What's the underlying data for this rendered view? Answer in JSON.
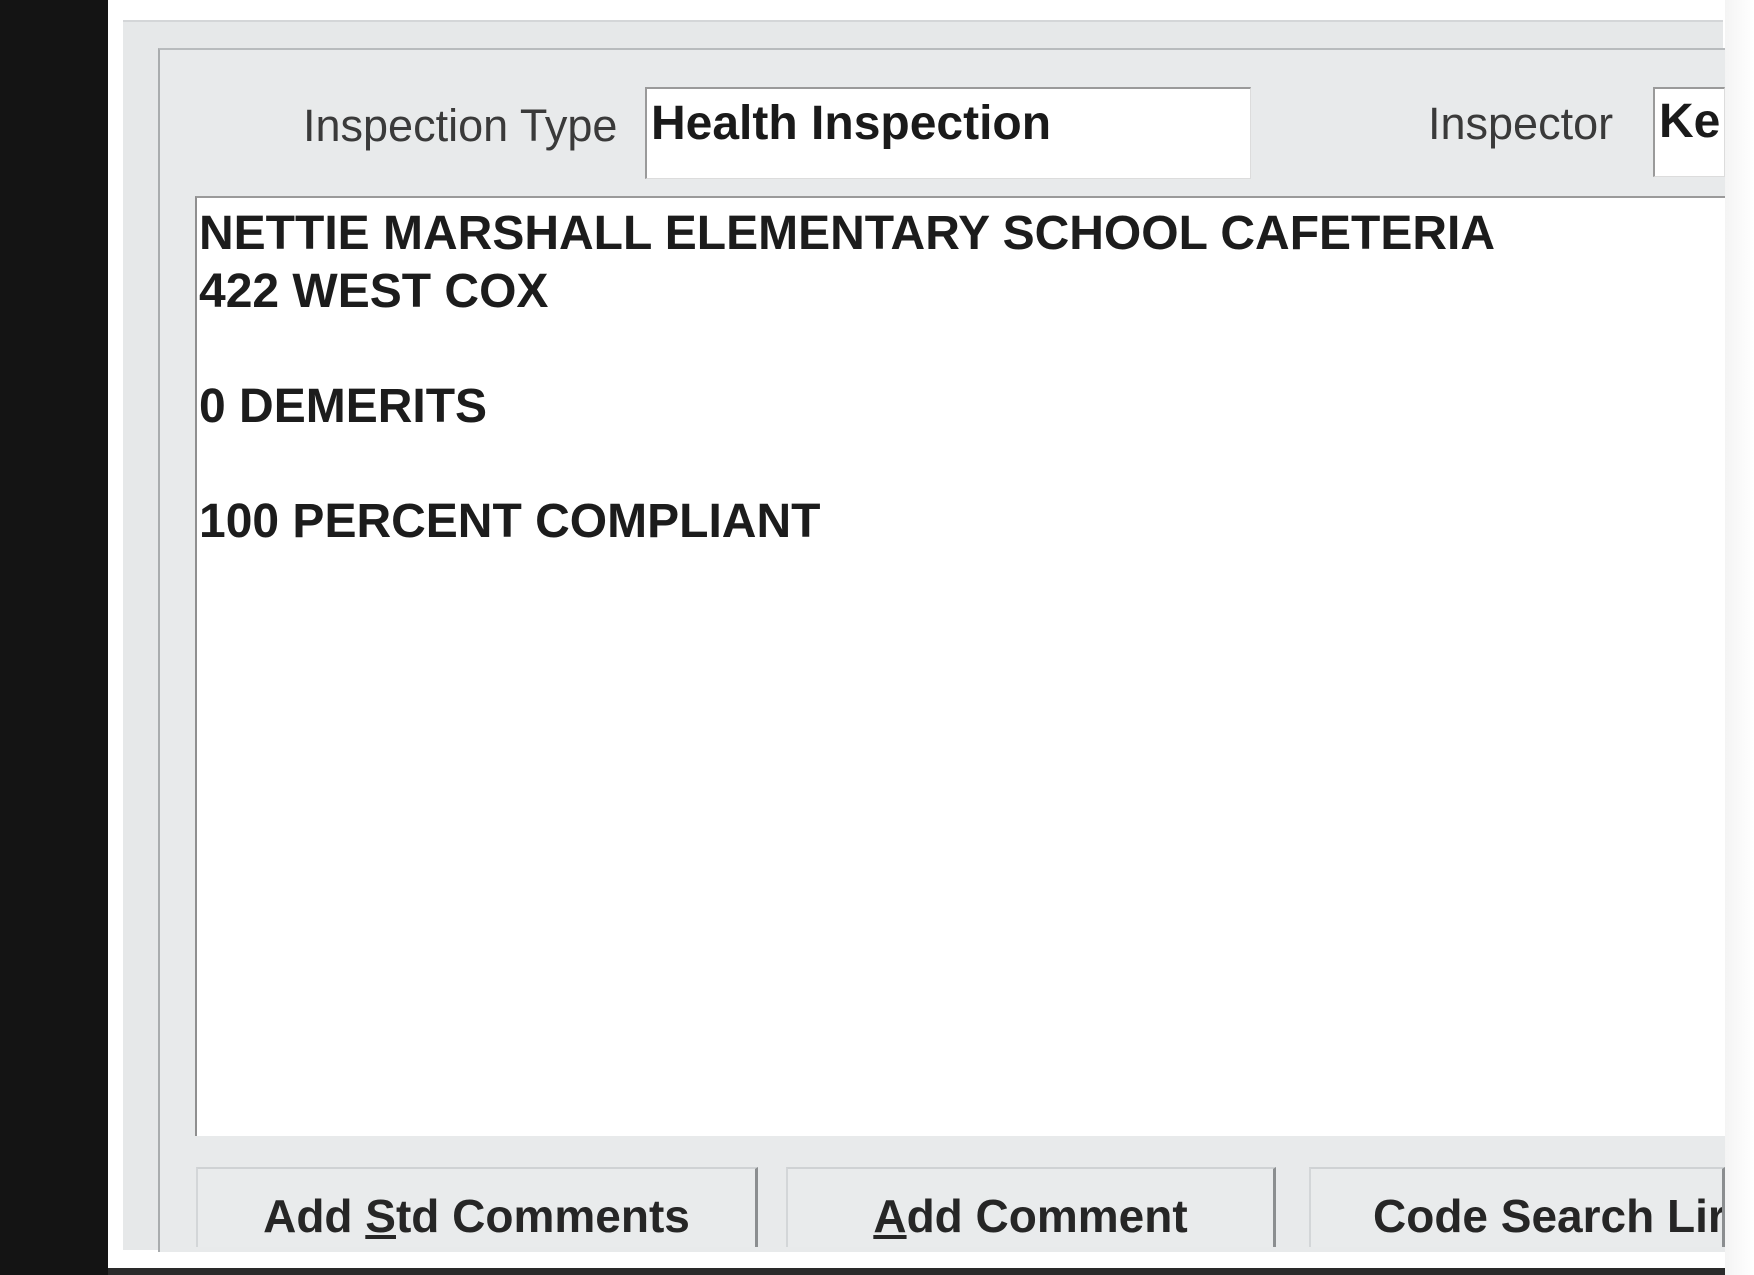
{
  "form": {
    "inspection_type_label": "Inspection Type",
    "inspection_type_value": "Health Inspection",
    "inspector_label": "Inspector",
    "inspector_value": "Ke"
  },
  "notes": {
    "lines": [
      "NETTIE MARSHALL ELEMENTARY SCHOOL CAFETERIA",
      "422 WEST COX",
      "",
      "0 DEMERITS",
      "",
      "100 PERCENT COMPLIANT"
    ]
  },
  "buttons": {
    "std_comments": {
      "before": "Add ",
      "mnemonic": "S",
      "after": "td Comments"
    },
    "add_comment": {
      "before": "",
      "mnemonic": "A",
      "after": "dd Comment"
    },
    "code_search": {
      "label": "Code Search Lir"
    }
  }
}
